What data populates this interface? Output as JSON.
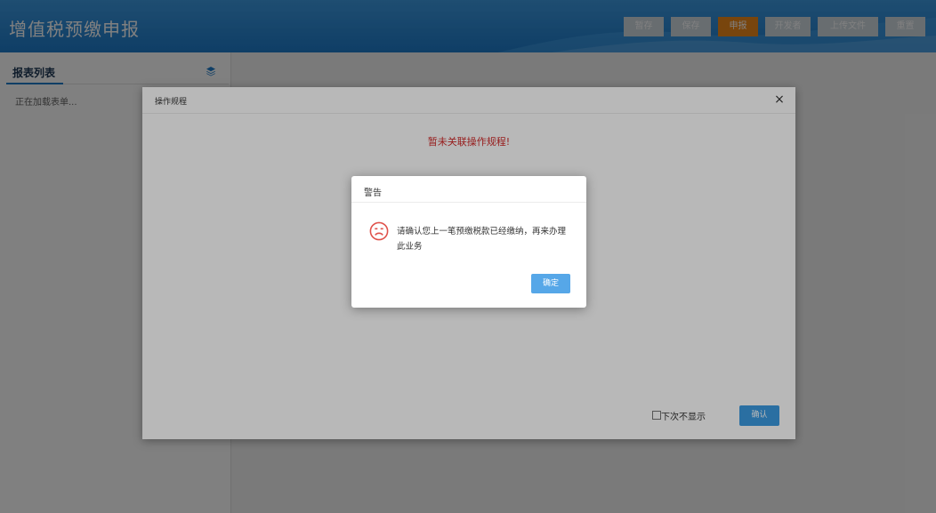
{
  "header": {
    "title": "增值税预缴申报",
    "toolbar": [
      {
        "label": "暂存",
        "primary": false
      },
      {
        "label": "保存",
        "primary": false
      },
      {
        "label": "申报",
        "primary": true
      },
      {
        "label": "开发者",
        "primary": false
      },
      {
        "label": "上传文件",
        "primary": false
      },
      {
        "label": "重置",
        "primary": false
      }
    ]
  },
  "sidebar": {
    "title": "报表列表",
    "icon": "layers-icon",
    "loading_text": "正在加载表单..."
  },
  "dialog": {
    "title": "操作规程",
    "close_label": "×",
    "message": "暂未关联操作规程!",
    "checkbox_label": "下次不显示",
    "checkbox_checked": false,
    "confirm_label": "确认"
  },
  "alert": {
    "title": "警告",
    "icon": "sad-face-icon",
    "message": "请确认您上一笔预缴税款已经缴纳，再来办理此业务",
    "ok_label": "确定"
  },
  "colors": {
    "header": "#1f7ccb",
    "primary_button": "#f08a1c",
    "dialog_confirm": "#3b9ae1",
    "error_text": "#d22a2a",
    "icon_red": "#e0524b"
  }
}
